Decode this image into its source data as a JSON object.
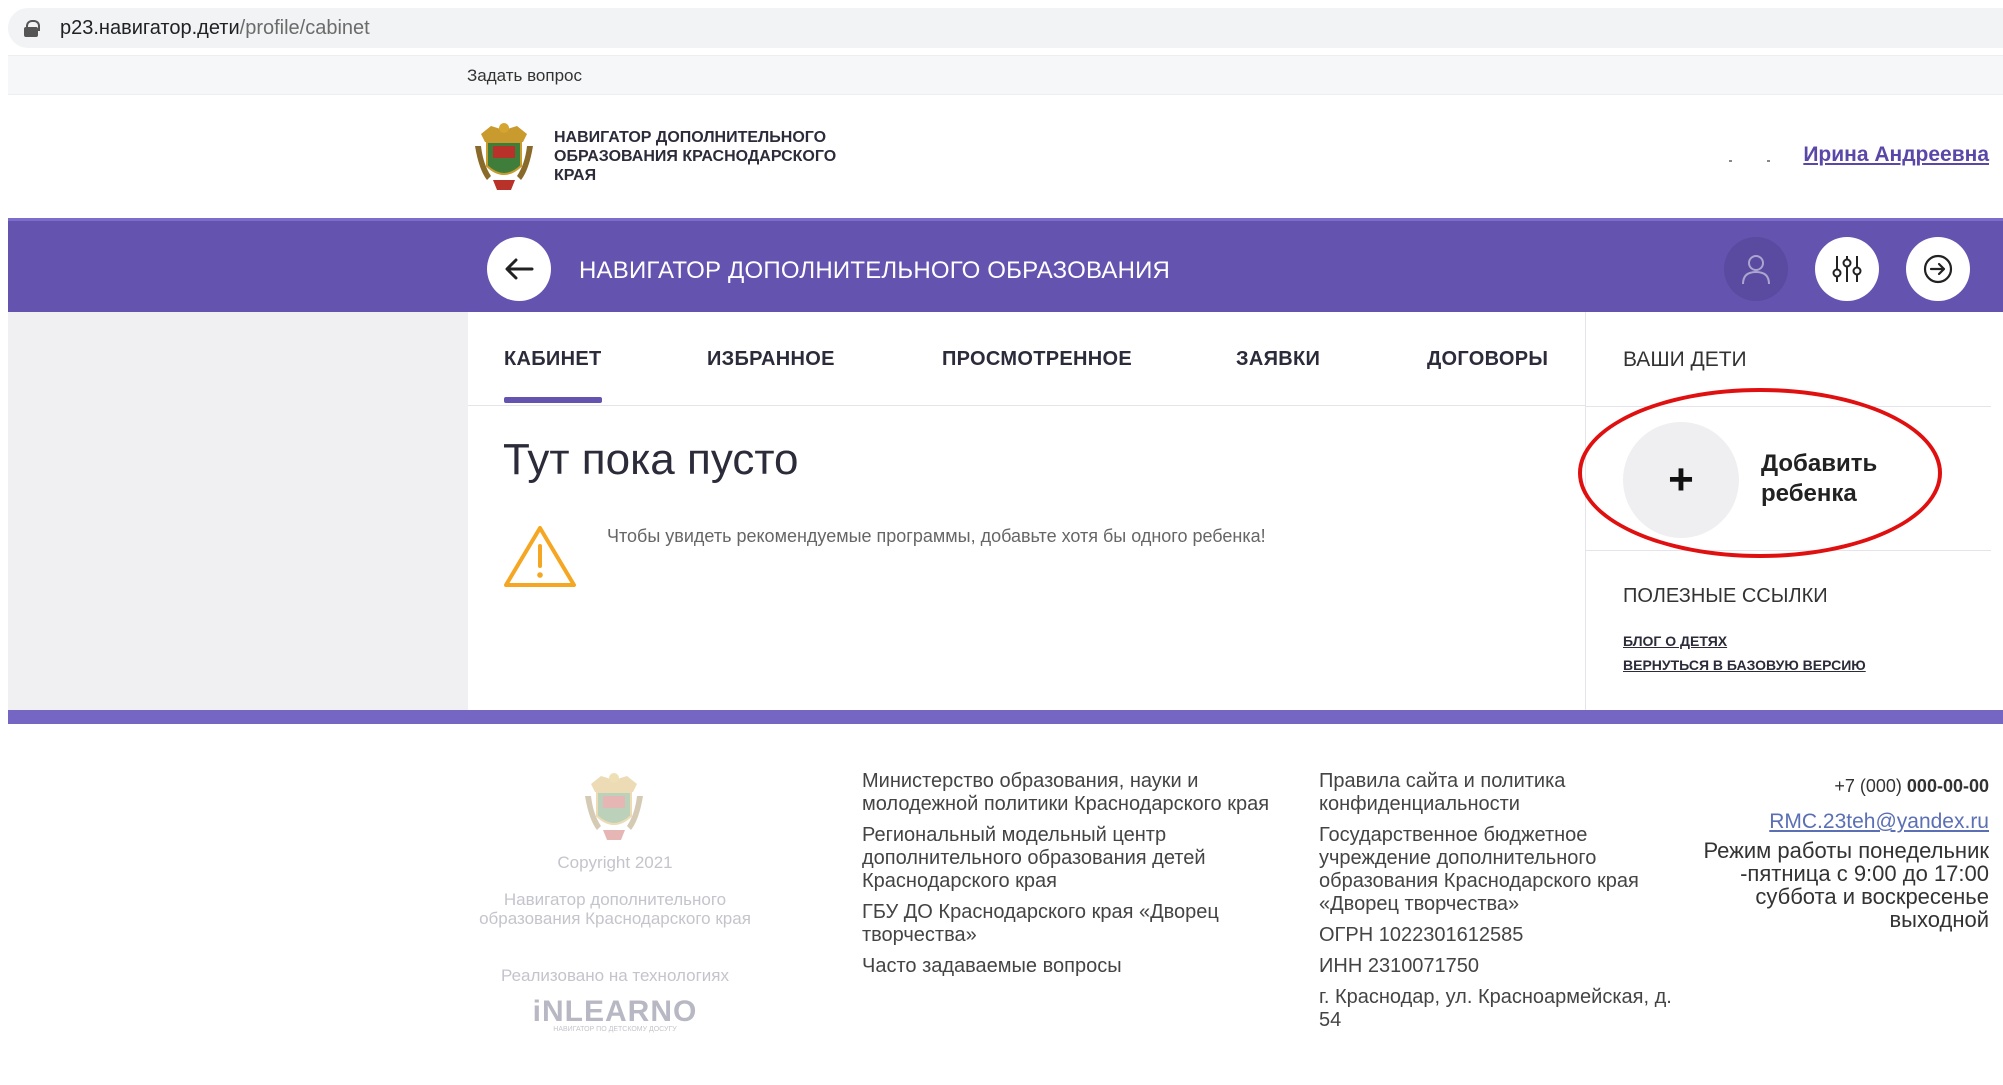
{
  "browser": {
    "url_host": "p23.навигатор.дети",
    "url_path": "/profile/cabinet"
  },
  "topbar": {
    "ask_question": "Задать вопрос"
  },
  "header": {
    "logo_text": "НАВИГАТОР ДОПОЛНИТЕЛЬНОГО ОБРАЗОВАНИЯ КРАСНОДАРСКОГО КРАЯ",
    "user_name": "Ирина Андреевна"
  },
  "navbar": {
    "title": "НАВИГАТОР ДОПОЛНИТЕЛЬНОГО ОБРАЗОВАНИЯ"
  },
  "tabs": [
    {
      "label": "КАБИНЕТ",
      "active": true
    },
    {
      "label": "ИЗБРАННОЕ",
      "active": false
    },
    {
      "label": "ПРОСМОТРЕННОЕ",
      "active": false
    },
    {
      "label": "ЗАЯВКИ",
      "active": false
    },
    {
      "label": "ДОГОВОРЫ",
      "active": false
    }
  ],
  "main": {
    "empty_title": "Тут пока пусто",
    "warning_text": "Чтобы увидеть рекомендуемые программы, добавьте хотя бы одного ребенка!"
  },
  "sidebar": {
    "children_heading": "ВАШИ ДЕТИ",
    "add_child_icon": "+",
    "add_child_label": "Добавить ребенка",
    "links_heading": "ПОЛЕЗНЫЕ ССЫЛКИ",
    "links": [
      "БЛОГ О ДЕТЯХ",
      "ВЕРНУТЬСЯ В БАЗОВУЮ ВЕРСИЮ"
    ]
  },
  "footer": {
    "copyright": "Copyright 2021",
    "site_name": "Навигатор дополнительного образования Краснодарского края",
    "tech_note": "Реализовано на технологиях",
    "brand": "iNLEARNO",
    "brand_sub": "НАВИГАТОР ПО ДЕТСКОМУ ДОСУГУ",
    "col2": [
      "Министерство образования, науки и молодежной политики Краснодарского края",
      "Региональный модельный центр дополнительного образования детей Краснодарского края",
      "ГБУ ДО Краснодарского края «Дворец творчества»",
      "Часто задаваемые вопросы"
    ],
    "col3": [
      "Правила сайта и политика конфиденциальности",
      "Государственное бюджетное учреждение дополнительного образования Краснодарского края «Дворец творчества»",
      "ОГРН 1022301612585",
      "ИНН 2310071750",
      "г. Краснодар, ул. Красноармейская, д. 54"
    ],
    "phone_prefix": "+7 (000)",
    "phone_number": "000-00-00",
    "email": "RMC.23teh@yandex.ru",
    "work_mode": "Режим работы понедельник -пятница с 9:00 до 17:00 суббота и воскресенье выходной"
  },
  "colors": {
    "brand_purple": "#6553b0",
    "annotation_red": "#e01010",
    "warning_orange": "#f5a623"
  },
  "icons": [
    "lock-icon",
    "back-arrow-icon",
    "user-icon",
    "filters-icon",
    "exit-icon",
    "warning-icon",
    "plus-icon",
    "emblem-logo"
  ]
}
